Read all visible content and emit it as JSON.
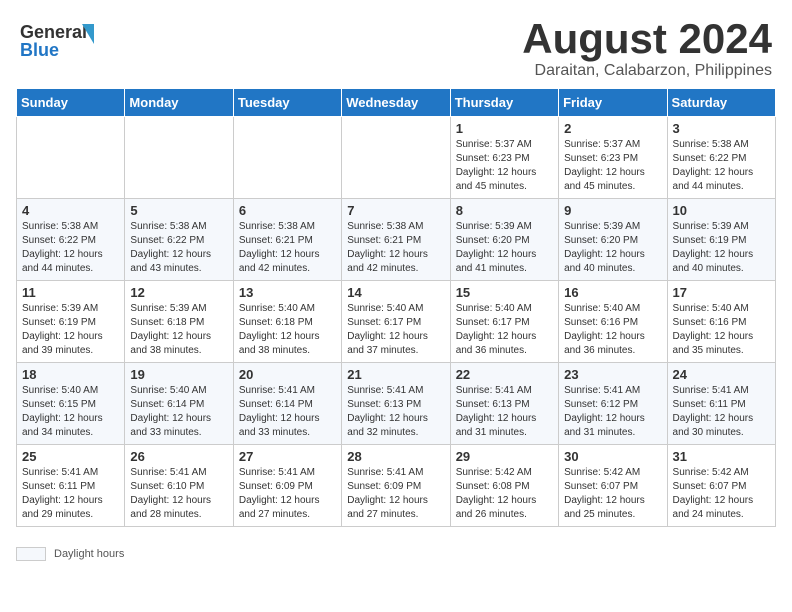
{
  "header": {
    "logo_text_general": "General",
    "logo_text_blue": "Blue",
    "month_year": "August 2024",
    "location": "Daraitan, Calabarzon, Philippines"
  },
  "calendar": {
    "days_of_week": [
      "Sunday",
      "Monday",
      "Tuesday",
      "Wednesday",
      "Thursday",
      "Friday",
      "Saturday"
    ],
    "weeks": [
      [
        {
          "day": "",
          "info": ""
        },
        {
          "day": "",
          "info": ""
        },
        {
          "day": "",
          "info": ""
        },
        {
          "day": "",
          "info": ""
        },
        {
          "day": "1",
          "info": "Sunrise: 5:37 AM\nSunset: 6:23 PM\nDaylight: 12 hours\nand 45 minutes."
        },
        {
          "day": "2",
          "info": "Sunrise: 5:37 AM\nSunset: 6:23 PM\nDaylight: 12 hours\nand 45 minutes."
        },
        {
          "day": "3",
          "info": "Sunrise: 5:38 AM\nSunset: 6:22 PM\nDaylight: 12 hours\nand 44 minutes."
        }
      ],
      [
        {
          "day": "4",
          "info": "Sunrise: 5:38 AM\nSunset: 6:22 PM\nDaylight: 12 hours\nand 44 minutes."
        },
        {
          "day": "5",
          "info": "Sunrise: 5:38 AM\nSunset: 6:22 PM\nDaylight: 12 hours\nand 43 minutes."
        },
        {
          "day": "6",
          "info": "Sunrise: 5:38 AM\nSunset: 6:21 PM\nDaylight: 12 hours\nand 42 minutes."
        },
        {
          "day": "7",
          "info": "Sunrise: 5:38 AM\nSunset: 6:21 PM\nDaylight: 12 hours\nand 42 minutes."
        },
        {
          "day": "8",
          "info": "Sunrise: 5:39 AM\nSunset: 6:20 PM\nDaylight: 12 hours\nand 41 minutes."
        },
        {
          "day": "9",
          "info": "Sunrise: 5:39 AM\nSunset: 6:20 PM\nDaylight: 12 hours\nand 40 minutes."
        },
        {
          "day": "10",
          "info": "Sunrise: 5:39 AM\nSunset: 6:19 PM\nDaylight: 12 hours\nand 40 minutes."
        }
      ],
      [
        {
          "day": "11",
          "info": "Sunrise: 5:39 AM\nSunset: 6:19 PM\nDaylight: 12 hours\nand 39 minutes."
        },
        {
          "day": "12",
          "info": "Sunrise: 5:39 AM\nSunset: 6:18 PM\nDaylight: 12 hours\nand 38 minutes."
        },
        {
          "day": "13",
          "info": "Sunrise: 5:40 AM\nSunset: 6:18 PM\nDaylight: 12 hours\nand 38 minutes."
        },
        {
          "day": "14",
          "info": "Sunrise: 5:40 AM\nSunset: 6:17 PM\nDaylight: 12 hours\nand 37 minutes."
        },
        {
          "day": "15",
          "info": "Sunrise: 5:40 AM\nSunset: 6:17 PM\nDaylight: 12 hours\nand 36 minutes."
        },
        {
          "day": "16",
          "info": "Sunrise: 5:40 AM\nSunset: 6:16 PM\nDaylight: 12 hours\nand 36 minutes."
        },
        {
          "day": "17",
          "info": "Sunrise: 5:40 AM\nSunset: 6:16 PM\nDaylight: 12 hours\nand 35 minutes."
        }
      ],
      [
        {
          "day": "18",
          "info": "Sunrise: 5:40 AM\nSunset: 6:15 PM\nDaylight: 12 hours\nand 34 minutes."
        },
        {
          "day": "19",
          "info": "Sunrise: 5:40 AM\nSunset: 6:14 PM\nDaylight: 12 hours\nand 33 minutes."
        },
        {
          "day": "20",
          "info": "Sunrise: 5:41 AM\nSunset: 6:14 PM\nDaylight: 12 hours\nand 33 minutes."
        },
        {
          "day": "21",
          "info": "Sunrise: 5:41 AM\nSunset: 6:13 PM\nDaylight: 12 hours\nand 32 minutes."
        },
        {
          "day": "22",
          "info": "Sunrise: 5:41 AM\nSunset: 6:13 PM\nDaylight: 12 hours\nand 31 minutes."
        },
        {
          "day": "23",
          "info": "Sunrise: 5:41 AM\nSunset: 6:12 PM\nDaylight: 12 hours\nand 31 minutes."
        },
        {
          "day": "24",
          "info": "Sunrise: 5:41 AM\nSunset: 6:11 PM\nDaylight: 12 hours\nand 30 minutes."
        }
      ],
      [
        {
          "day": "25",
          "info": "Sunrise: 5:41 AM\nSunset: 6:11 PM\nDaylight: 12 hours\nand 29 minutes."
        },
        {
          "day": "26",
          "info": "Sunrise: 5:41 AM\nSunset: 6:10 PM\nDaylight: 12 hours\nand 28 minutes."
        },
        {
          "day": "27",
          "info": "Sunrise: 5:41 AM\nSunset: 6:09 PM\nDaylight: 12 hours\nand 27 minutes."
        },
        {
          "day": "28",
          "info": "Sunrise: 5:41 AM\nSunset: 6:09 PM\nDaylight: 12 hours\nand 27 minutes."
        },
        {
          "day": "29",
          "info": "Sunrise: 5:42 AM\nSunset: 6:08 PM\nDaylight: 12 hours\nand 26 minutes."
        },
        {
          "day": "30",
          "info": "Sunrise: 5:42 AM\nSunset: 6:07 PM\nDaylight: 12 hours\nand 25 minutes."
        },
        {
          "day": "31",
          "info": "Sunrise: 5:42 AM\nSunset: 6:07 PM\nDaylight: 12 hours\nand 24 minutes."
        }
      ]
    ]
  },
  "legend": {
    "label": "Daylight hours"
  }
}
